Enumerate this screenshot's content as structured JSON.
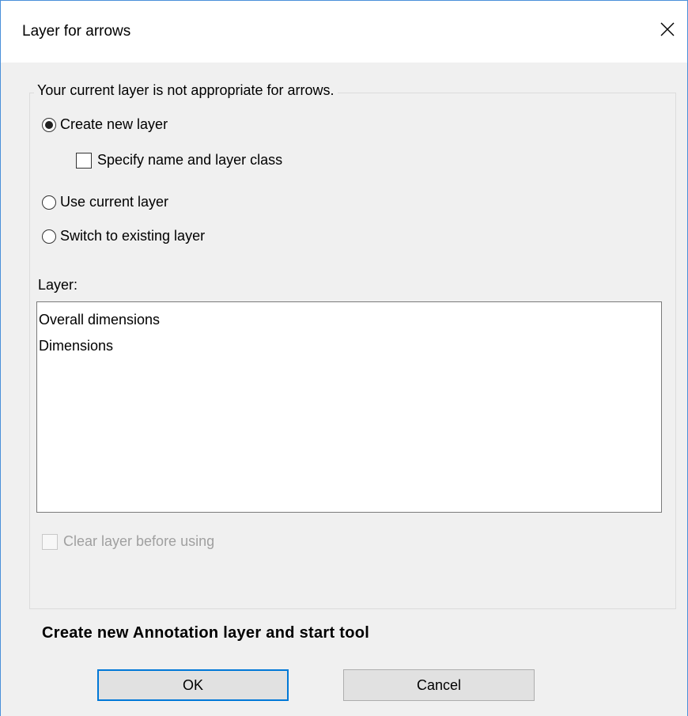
{
  "window": {
    "title": "Layer for arrows"
  },
  "icons": {
    "close": "close-icon"
  },
  "group": {
    "legend": "Your current layer is not appropriate for arrows.",
    "options": [
      {
        "label": "Create new layer",
        "selected": true
      },
      {
        "label": "Use current layer",
        "selected": false
      },
      {
        "label": "Switch to existing layer",
        "selected": false
      }
    ],
    "specify_checkbox": {
      "label": "Specify name and layer class",
      "checked": false
    },
    "layer_label": "Layer:",
    "layer_list": [
      "Overall dimensions",
      "Dimensions"
    ],
    "clear_checkbox": {
      "label": "Clear layer before using",
      "checked": false,
      "enabled": false
    }
  },
  "status_text": "Create new Annotation layer and start tool",
  "buttons": {
    "ok": "OK",
    "cancel": "Cancel"
  },
  "colors": {
    "accent": "#0078d7",
    "border_blue": "#4a90d9",
    "dialog_bg": "#f0f0f0"
  }
}
